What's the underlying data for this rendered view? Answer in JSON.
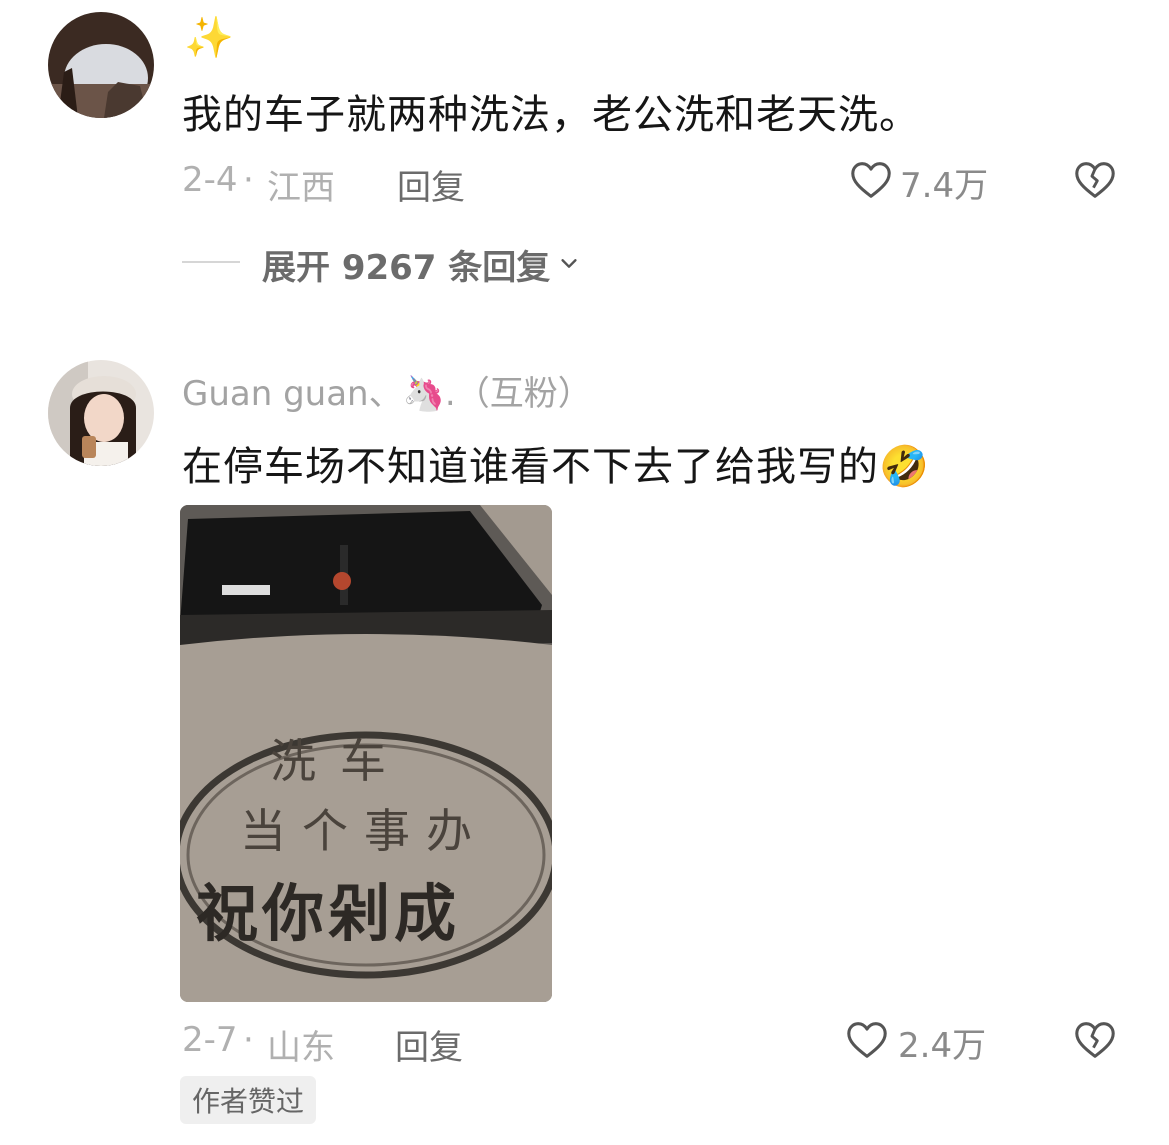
{
  "comments": [
    {
      "username": "✨",
      "text": "我的车子就两种洗法，老公洗和老天洗。",
      "date": "2-4",
      "location": "江西",
      "reply_label": "回复",
      "likes": "7.4万",
      "expand_replies": "展开 9267 条回复"
    },
    {
      "username": "Guan guan、🦄.（互粉）",
      "text": "在停车场不知道谁看不下去了给我写的🤣",
      "image_text": [
        "洗车",
        "当个事办",
        "祝你剁成"
      ],
      "date": "2-7",
      "location": "山东",
      "reply_label": "回复",
      "likes": "2.4万",
      "author_tag": "作者赞过"
    }
  ],
  "icons": {
    "like": "heart-outline-icon",
    "dislike": "broken-heart-icon",
    "expand": "chevron-down-icon"
  },
  "colors": {
    "meta_gray": "#b0b0b0",
    "text_dark": "#161616"
  }
}
